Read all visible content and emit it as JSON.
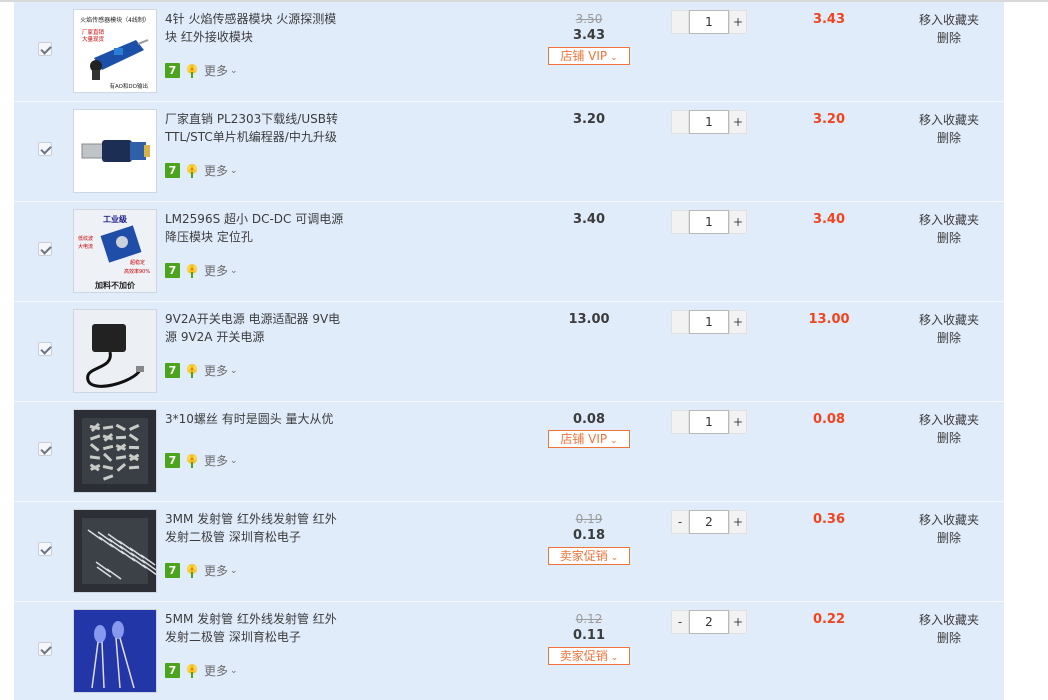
{
  "cart": {
    "items": [
      {
        "title": "4针 火焰传感器模块 火源探测模块 红外接收模块",
        "original_price": "3.50",
        "price": "3.43",
        "promo": "店铺 VIP",
        "quantity": "1",
        "minus": "-",
        "plus": "+",
        "subtotal": "3.43",
        "more": "更多",
        "badge": "7",
        "favorite": "移入收藏夹",
        "delete": "删除",
        "image_text": [
          "火焰传感器模块（4线制）",
          "厂家直销",
          "大量现货",
          "有AO和DO输出"
        ]
      },
      {
        "title": "厂家直销 PL2303下载线/USB转TTL/STC单片机编程器/中九升级",
        "original_price": "",
        "price": "3.20",
        "promo": "",
        "quantity": "1",
        "minus": "-",
        "plus": "+",
        "subtotal": "3.20",
        "more": "更多",
        "badge": "7",
        "favorite": "移入收藏夹",
        "delete": "删除",
        "image_text": []
      },
      {
        "title": "LM2596S 超小 DC-DC 可调电源降压模块 定位孔",
        "original_price": "",
        "price": "3.40",
        "promo": "",
        "quantity": "1",
        "minus": "-",
        "plus": "+",
        "subtotal": "3.40",
        "more": "更多",
        "badge": "7",
        "favorite": "移入收藏夹",
        "delete": "删除",
        "image_text": [
          "工业级",
          "低纹波",
          "大电流",
          "超稳定",
          "高效率90%",
          "加料不加价"
        ]
      },
      {
        "title": "9V2A开关电源 电源适配器 9V电源 9V2A 开关电源",
        "original_price": "",
        "price": "13.00",
        "promo": "",
        "quantity": "1",
        "minus": "-",
        "plus": "+",
        "subtotal": "13.00",
        "more": "更多",
        "badge": "7",
        "favorite": "移入收藏夹",
        "delete": "删除",
        "image_text": []
      },
      {
        "title": "3*10螺丝 有时是圆头 量大从优",
        "original_price": "",
        "price": "0.08",
        "promo": "店铺 VIP",
        "quantity": "1",
        "minus": "-",
        "plus": "+",
        "subtotal": "0.08",
        "more": "更多",
        "badge": "7",
        "favorite": "移入收藏夹",
        "delete": "删除",
        "image_text": []
      },
      {
        "title": "3MM 发射管 红外线发射管 红外发射二极管 深圳育松电子",
        "original_price": "0.19",
        "price": "0.18",
        "promo": "卖家促销",
        "quantity": "2",
        "minus": "-",
        "plus": "+",
        "subtotal": "0.36",
        "more": "更多",
        "badge": "7",
        "favorite": "移入收藏夹",
        "delete": "删除",
        "image_text": []
      },
      {
        "title": "5MM 发射管 红外线发射管 红外发射二极管 深圳育松电子",
        "original_price": "0.12",
        "price": "0.11",
        "promo": "卖家促销",
        "quantity": "2",
        "minus": "-",
        "plus": "+",
        "subtotal": "0.22",
        "more": "更多",
        "badge": "7",
        "favorite": "移入收藏夹",
        "delete": "删除",
        "image_text": []
      }
    ]
  },
  "colors": {
    "row_bg": "#e1ecfb",
    "accent_orange": "#f0733a",
    "subtotal_red": "#f2441c",
    "badge_green": "#4aa51c"
  },
  "icons": [
    "checkbox-checked-icon",
    "tmall-7-badge-icon",
    "flower-badge-icon",
    "chevron-down-icon"
  ]
}
